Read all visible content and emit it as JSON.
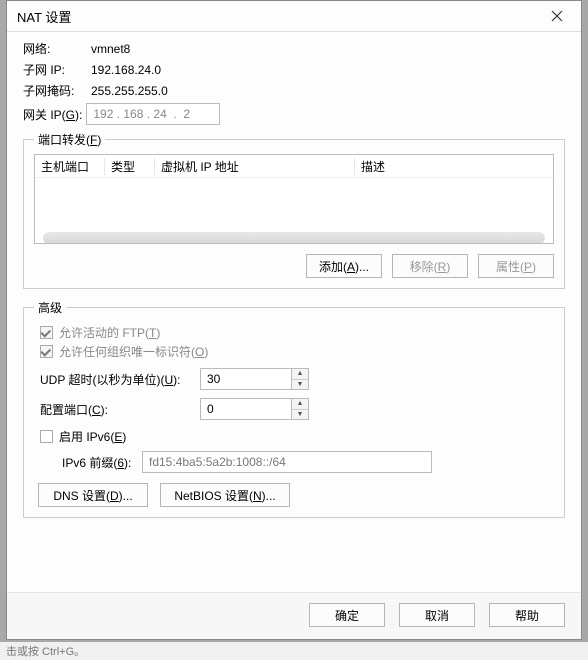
{
  "window": {
    "title": "NAT 设置"
  },
  "net": {
    "network_label": "网络:",
    "network_value": "vmnet8",
    "subnet_ip_label": "子网 IP:",
    "subnet_ip_value": "192.168.24.0",
    "subnet_mask_label": "子网掩码:",
    "subnet_mask_value": "255.255.255.0",
    "gateway_label_pre": "网关 IP(",
    "gateway_key": "G",
    "gateway_label_post": "):",
    "gateway_value": "192 . 168 . 24  .  2"
  },
  "portfwd": {
    "legend_pre": "端口转发(",
    "legend_key": "F",
    "legend_post": ")",
    "cols": {
      "host_port": "主机端口",
      "type": "类型",
      "vm_ip": "虚拟机 IP 地址",
      "desc": "描述"
    },
    "buttons": {
      "add_pre": "添加(",
      "add_key": "A",
      "add_post": ")...",
      "remove_pre": "移除(",
      "remove_key": "R",
      "remove_post": ")",
      "props_pre": "属性(",
      "props_key": "P",
      "props_post": ")"
    }
  },
  "adv": {
    "legend": "高级",
    "ftp_pre": "允许活动的 FTP(",
    "ftp_key": "T",
    "ftp_post": ")",
    "oui_pre": "允许任何组织唯一标识符(",
    "oui_key": "O",
    "oui_post": ")",
    "udp_pre": "UDP 超时(以秒为单位)(",
    "udp_key": "U",
    "udp_post": "):",
    "udp_value": "30",
    "cfgport_pre": "配置端口(",
    "cfgport_key": "C",
    "cfgport_post": "):",
    "cfgport_value": "0",
    "ipv6_pre": "启用 IPv6(",
    "ipv6_key": "E",
    "ipv6_post": ")",
    "ipv6prefix_pre": "IPv6 前缀(",
    "ipv6prefix_key": "6",
    "ipv6prefix_post": "):",
    "ipv6prefix_value": "fd15:4ba5:5a2b:1008::/64",
    "dns_pre": "DNS 设置(",
    "dns_key": "D",
    "dns_post": ")...",
    "netbios_pre": "NetBIOS 设置(",
    "netbios_key": "N",
    "netbios_post": ")..."
  },
  "footer": {
    "ok": "确定",
    "cancel": "取消",
    "help": "帮助"
  },
  "bg": {
    "hint": "击或按 Ctrl+G。"
  }
}
